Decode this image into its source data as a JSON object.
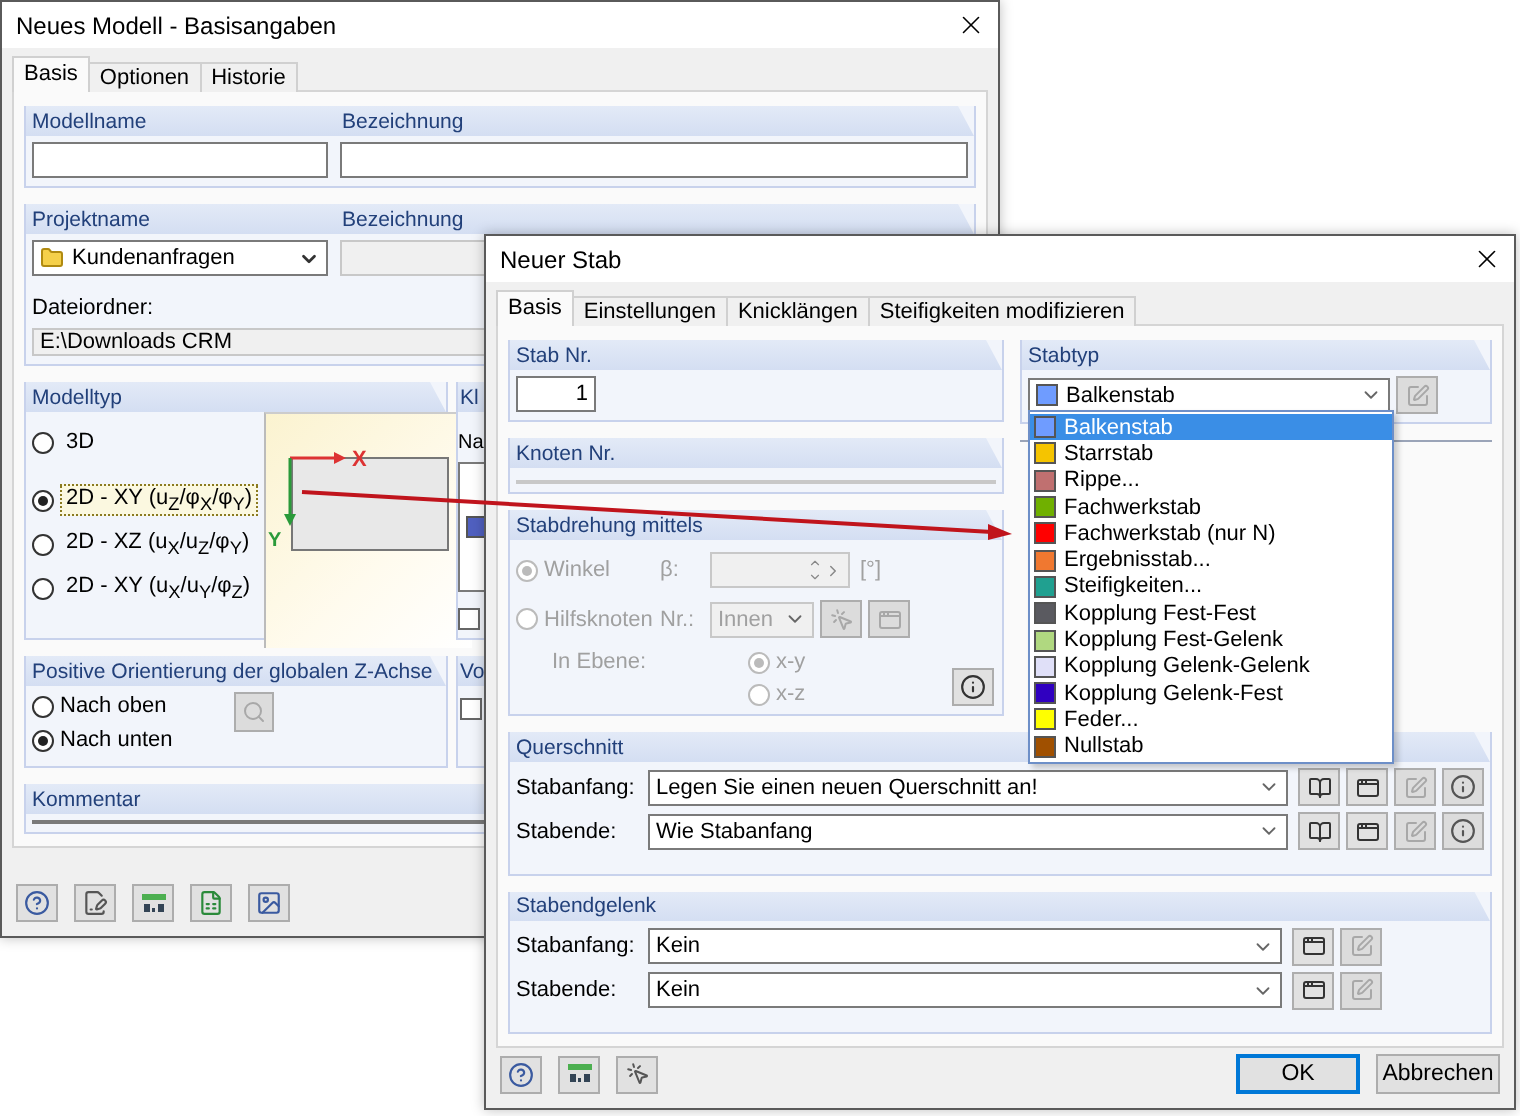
{
  "back_window": {
    "title": "Neues Modell - Basisangaben",
    "tabs": [
      {
        "label": "Basis",
        "selected": true
      },
      {
        "label": "Optionen",
        "selected": false
      },
      {
        "label": "Historie",
        "selected": false
      }
    ],
    "model": {
      "name_label": "Modellname",
      "description_label": "Bezeichnung"
    },
    "project": {
      "name_label": "Projektname",
      "description_label": "Bezeichnung",
      "name_value": "Kundenanfragen",
      "folder_label": "Dateiordner:",
      "folder_value": "E:\\Downloads CRM"
    },
    "model_type": {
      "title": "Modelltyp",
      "axis_x": "X",
      "axis_y": "Y",
      "options": [
        {
          "label": "3D",
          "selected": false
        },
        {
          "label": "2D - XY (u$_{Z}$/φ$_{X}$/φ$_{Y}$)",
          "selected": true
        },
        {
          "label": "2D - XZ (u$_{X}$/u$_{Z}$/φ$_{Y}$)",
          "selected": false
        },
        {
          "label": "2D - XY (u$_{X}$/u$_{Y}$/φ$_{Z}$)",
          "selected": false
        }
      ]
    },
    "side_group_1": {
      "title": "Kl",
      "label": "Na",
      "checked": false
    },
    "z_axis": {
      "title": "Positive Orientierung der globalen Z-Achse",
      "options": [
        {
          "label": "Nach oben",
          "selected": false
        },
        {
          "label": "Nach unten",
          "selected": true
        }
      ]
    },
    "side_group_2": {
      "title": "Vo",
      "checked": false
    },
    "comment": {
      "title": "Kommentar"
    }
  },
  "front_window": {
    "title": "Neuer Stab",
    "tabs": [
      {
        "label": "Basis",
        "selected": true
      },
      {
        "label": "Einstellungen",
        "selected": false
      },
      {
        "label": "Knicklängen",
        "selected": false
      },
      {
        "label": "Steifigkeiten modifizieren",
        "selected": false
      }
    ],
    "member_no": {
      "title": "Stab Nr.",
      "value": "1"
    },
    "node_no": {
      "title": "Knoten Nr."
    },
    "rotation": {
      "title": "Stabdrehung mittels",
      "disabled": true,
      "options": [
        {
          "label": "Winkel",
          "selected": true
        },
        {
          "label": "Hilfsknoten",
          "selected": false
        }
      ],
      "beta_label": "β:",
      "unit": "[°]",
      "nr_label": "Nr.:",
      "nr_value": "Innen",
      "plane_label": "In Ebene:",
      "plane_options": [
        {
          "label": "x-y",
          "selected": true
        },
        {
          "label": "x-z",
          "selected": false
        }
      ]
    },
    "member_type": {
      "title": "Stabtyp",
      "value": "Balkenstab",
      "color": "#6f9cff",
      "options": [
        {
          "label": "Balkenstab",
          "color": "#6f9cff",
          "selected": true
        },
        {
          "label": "Starrstab",
          "color": "#f5c400",
          "selected": false
        },
        {
          "label": "Rippe...",
          "color": "#c07070",
          "selected": false
        },
        {
          "label": "Fachwerkstab",
          "color": "#70b000",
          "selected": false
        },
        {
          "label": "Fachwerkstab (nur N)",
          "color": "#ff0000",
          "selected": false
        },
        {
          "label": "Ergebnisstab...",
          "color": "#f07830",
          "selected": false
        },
        {
          "label": "Steifigkeiten...",
          "color": "#20a090",
          "selected": false
        },
        {
          "label": "Kopplung Fest-Fest",
          "color": "#5a5a60",
          "selected": false
        },
        {
          "label": "Kopplung Fest-Gelenk",
          "color": "#b0d880",
          "selected": false
        },
        {
          "label": "Kopplung Gelenk-Gelenk",
          "color": "#e0e0f8",
          "selected": false
        },
        {
          "label": "Kopplung Gelenk-Fest",
          "color": "#3000c0",
          "selected": false
        },
        {
          "label": "Feder...",
          "color": "#ffff00",
          "selected": false
        },
        {
          "label": "Nullstab",
          "color": "#a05000",
          "selected": false
        }
      ]
    },
    "section": {
      "title": "Querschnitt",
      "rows": [
        {
          "label": "Stabanfang:",
          "value": "Legen Sie einen neuen Querschnitt an!"
        },
        {
          "label": "Stabende:",
          "value": "Wie Stabanfang"
        }
      ]
    },
    "hinge": {
      "title": "Stabendgelenk",
      "rows": [
        {
          "label": "Stabanfang:",
          "value": "Kein"
        },
        {
          "label": "Stabende:",
          "value": "Kein"
        }
      ]
    },
    "buttons": [
      {
        "label": "OK",
        "default": true
      },
      {
        "label": "Abbrechen",
        "default": false
      }
    ]
  }
}
